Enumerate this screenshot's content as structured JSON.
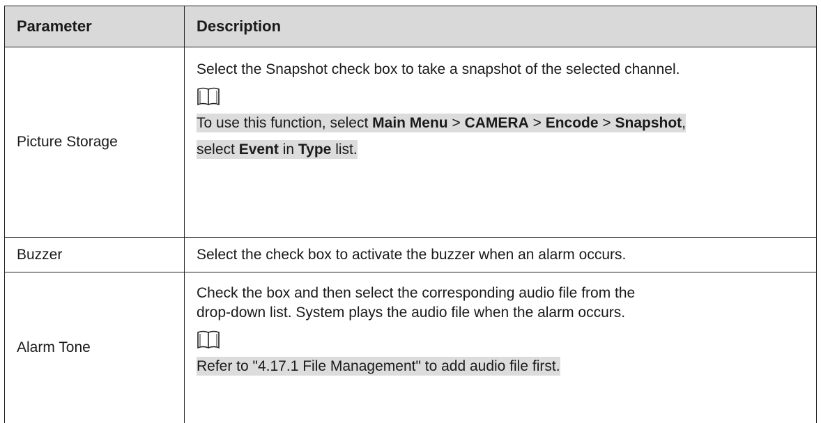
{
  "table": {
    "headers": {
      "parameter": "Parameter",
      "description": "Description"
    },
    "rows": [
      {
        "parameter": "Picture Storage",
        "description": "Select the Snapshot check box to take a snapshot of the selected channel.",
        "note_icon": "book-icon",
        "note": {
          "t1": "To use this function, select ",
          "b1": "Main Menu",
          "t2": " > ",
          "b2": "CAMERA",
          "t3": " > ",
          "b3": "Encode",
          "t4": " > ",
          "b4": "Snapshot",
          "t5": ",",
          "t6": "select ",
          "b5": "Event",
          "t7": " in ",
          "b6": "Type",
          "t8": " list."
        }
      },
      {
        "parameter": "Buzzer",
        "description": "Select the check box to activate the buzzer when an alarm occurs."
      },
      {
        "parameter": "Alarm Tone",
        "description_line1": "Check the box and then select the corresponding audio file from the",
        "description_line2": "drop-down list. System plays the audio file when the alarm occurs.",
        "note_icon": "book-icon",
        "note": "Refer to \"4.17.1 File Management\" to add audio file first."
      }
    ]
  }
}
